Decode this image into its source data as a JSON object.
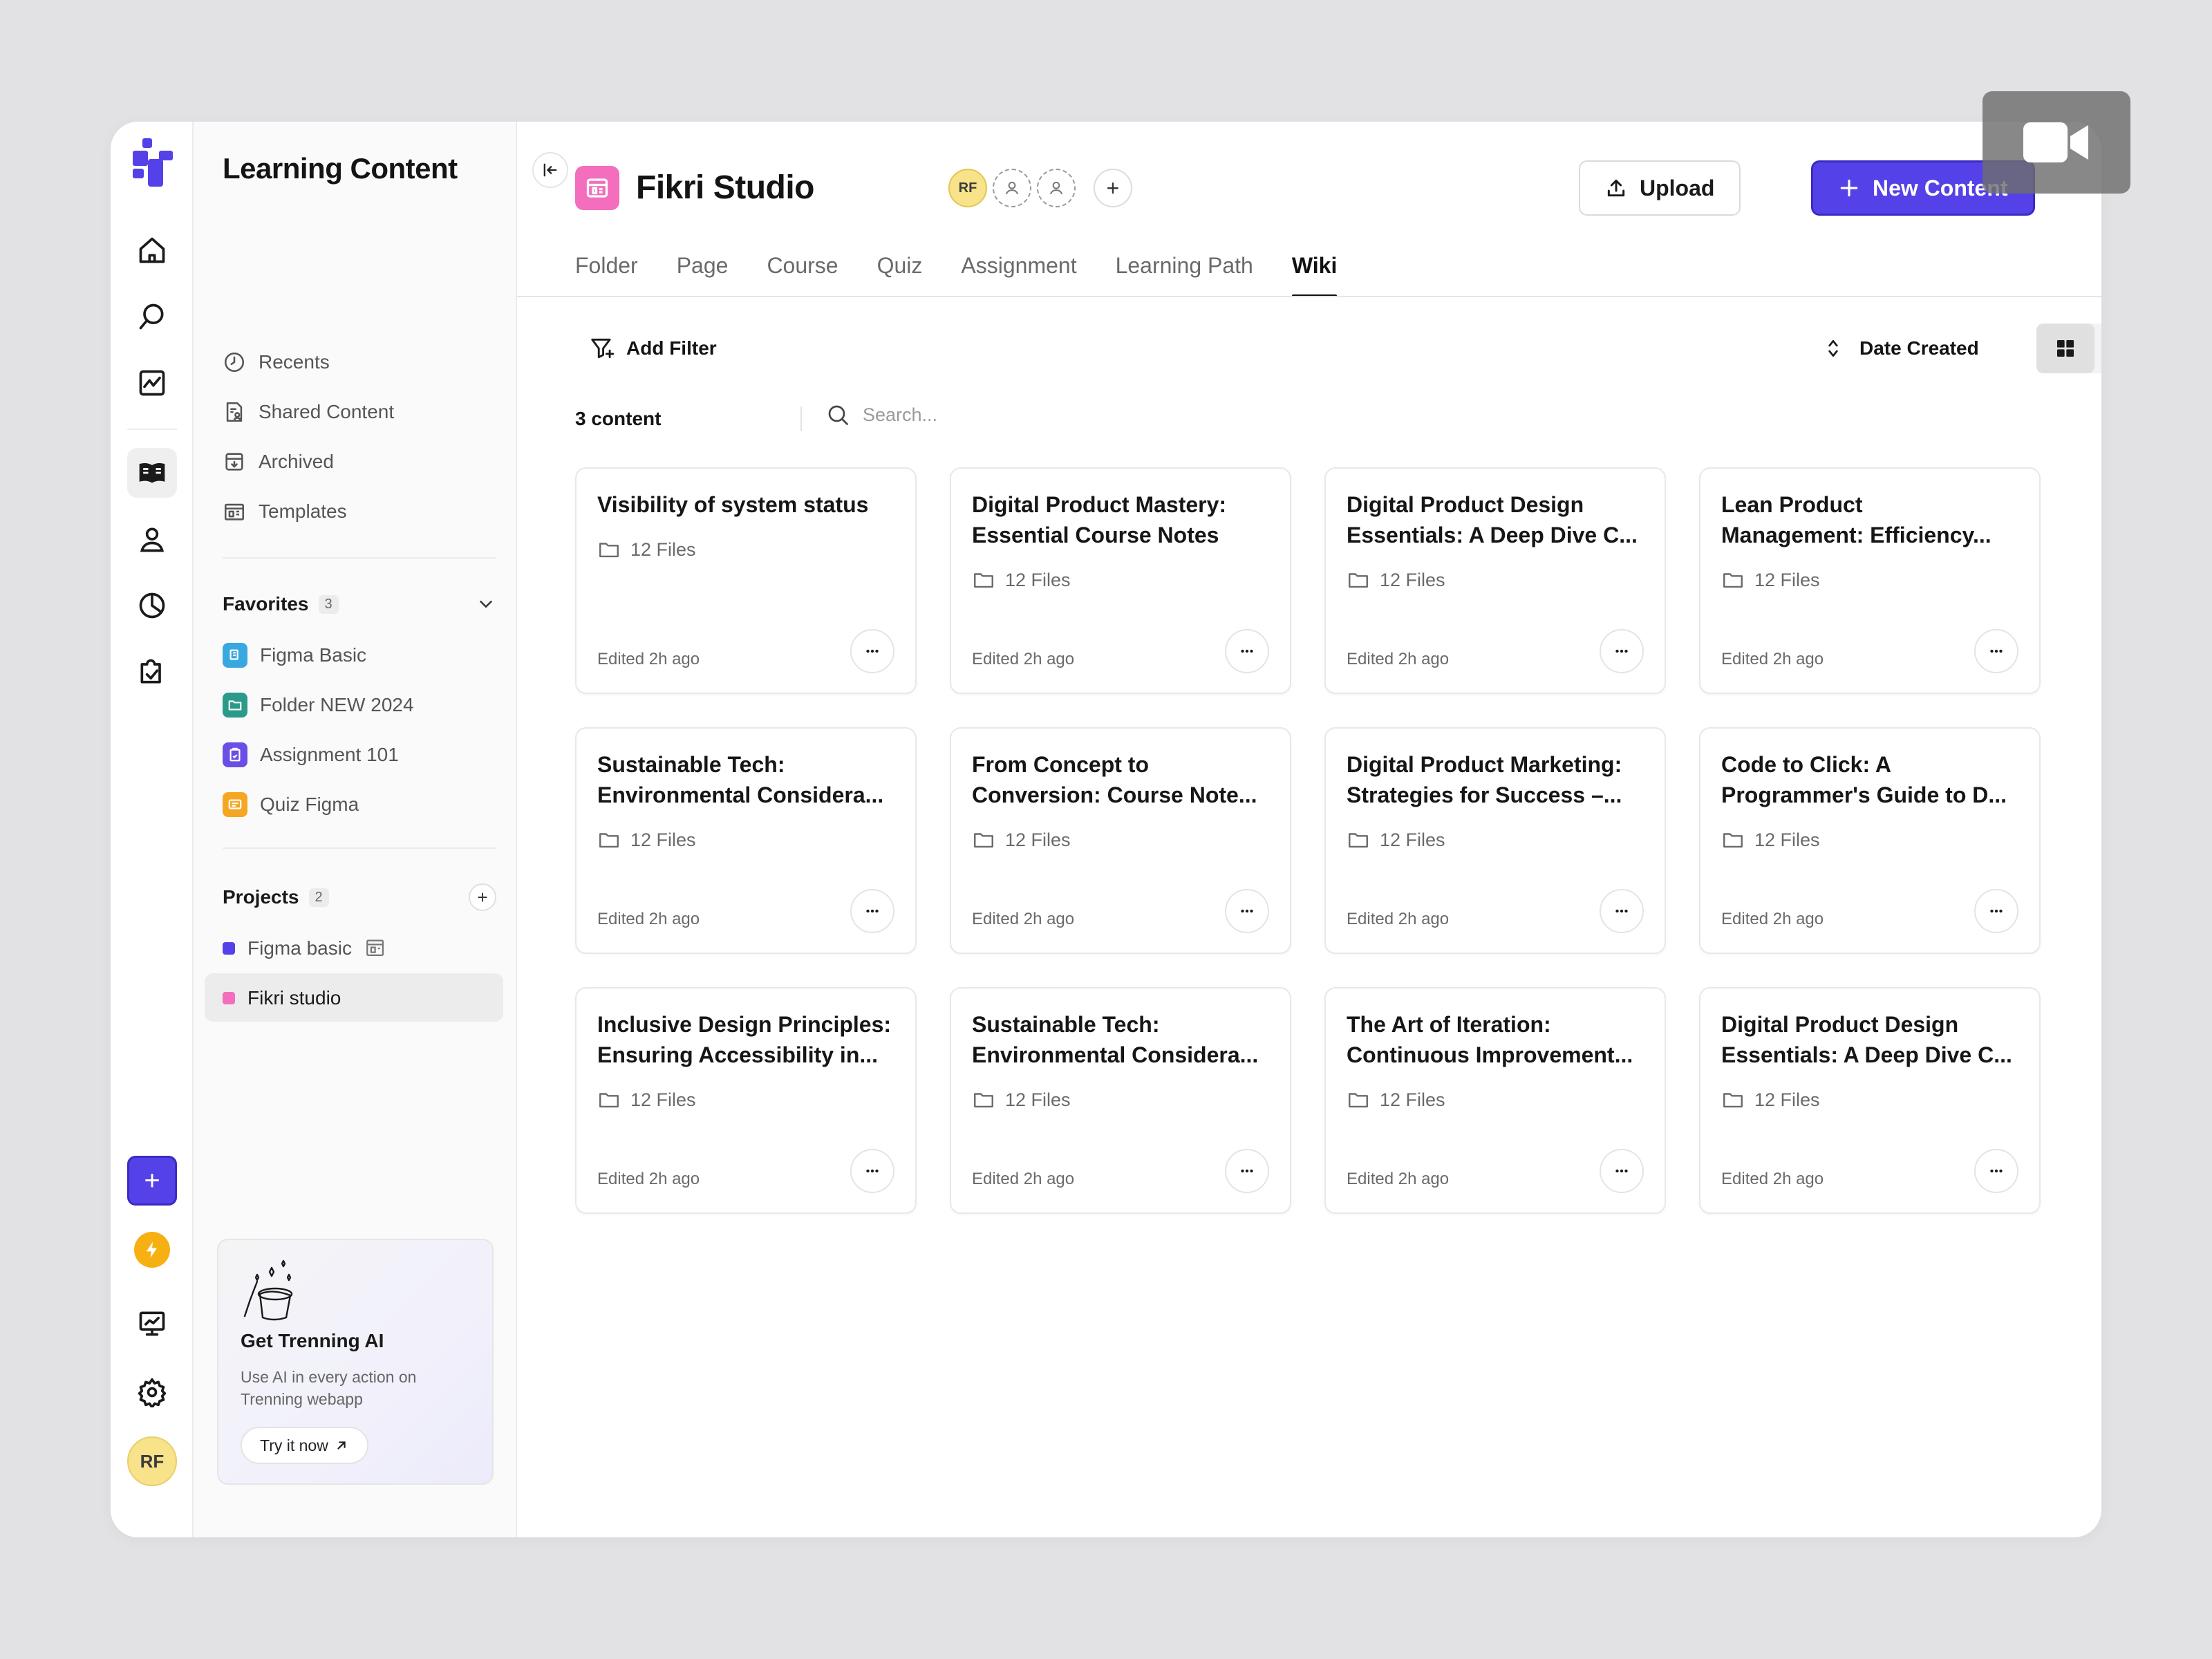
{
  "sidebar": {
    "title": "Learning Content",
    "nav": [
      {
        "label": "Recents",
        "icon": "clock-icon"
      },
      {
        "label": "Shared Content",
        "icon": "shared-doc-icon"
      },
      {
        "label": "Archived",
        "icon": "archive-icon"
      },
      {
        "label": "Templates",
        "icon": "template-icon"
      }
    ],
    "favorites": {
      "label": "Favorites",
      "count": "3",
      "items": [
        {
          "label": "Figma Basic",
          "color": "#3aa8e0"
        },
        {
          "label": "Folder NEW 2024",
          "color": "#2c9a8a"
        },
        {
          "label": "Assignment 101",
          "color": "#6a4ee6"
        },
        {
          "label": "Quiz Figma",
          "color": "#f5a623"
        }
      ]
    },
    "projects": {
      "label": "Projects",
      "count": "2",
      "items": [
        {
          "label": "Figma basic",
          "color": "#5541e8"
        },
        {
          "label": "Fikri studio",
          "color": "#f36ebd"
        }
      ]
    },
    "ai_card": {
      "title": "Get Trenning AI",
      "description": "Use AI in every action on Trenning webapp",
      "button": "Try it now"
    }
  },
  "rail": {
    "avatar": "RF",
    "accent": "#5541e8"
  },
  "header": {
    "title": "Fikri Studio",
    "member_initials": "RF",
    "upload_label": "Upload",
    "new_label": "New Content"
  },
  "tabs": [
    {
      "label": "Folder"
    },
    {
      "label": "Page"
    },
    {
      "label": "Course"
    },
    {
      "label": "Quiz"
    },
    {
      "label": "Assignment"
    },
    {
      "label": "Learning Path"
    },
    {
      "label": "Wiki",
      "active": true
    }
  ],
  "toolbar": {
    "filter_label": "Add Filter",
    "sort_label": "Date Created",
    "content_count": "3 content",
    "search_placeholder": "Search..."
  },
  "cards": [
    {
      "title1": "Visibility of system status",
      "title2": "",
      "files": "12 Files",
      "edited": "Edited 2h ago"
    },
    {
      "title1": "Digital Product Mastery:",
      "title2": "Essential Course Notes",
      "files": "12 Files",
      "edited": "Edited 2h ago"
    },
    {
      "title1": "Digital Product Design",
      "title2": "Essentials: A Deep Dive C...",
      "files": "12 Files",
      "edited": "Edited 2h ago"
    },
    {
      "title1": "Lean Product",
      "title2": "Management: Efficiency...",
      "files": "12 Files",
      "edited": "Edited 2h ago"
    },
    {
      "title1": "Sustainable Tech:",
      "title2": "Environmental Considera...",
      "files": "12 Files",
      "edited": "Edited 2h ago"
    },
    {
      "title1": "From Concept to",
      "title2": "Conversion: Course Note...",
      "files": "12 Files",
      "edited": "Edited 2h ago"
    },
    {
      "title1": "Digital Product Marketing:",
      "title2": "Strategies for Success –...",
      "files": "12 Files",
      "edited": "Edited 2h ago"
    },
    {
      "title1": "Code to Click: A",
      "title2": "Programmer's Guide to D...",
      "files": "12 Files",
      "edited": "Edited 2h ago"
    },
    {
      "title1": "Inclusive Design Principles:",
      "title2": "Ensuring Accessibility in...",
      "files": "12 Files",
      "edited": "Edited 2h ago"
    },
    {
      "title1": "Sustainable Tech:",
      "title2": "Environmental Considera...",
      "files": "12 Files",
      "edited": "Edited 2h ago"
    },
    {
      "title1": "The Art of Iteration:",
      "title2": "Continuous Improvement...",
      "files": "12 Files",
      "edited": "Edited 2h ago"
    },
    {
      "title1": "Digital Product Design",
      "title2": "Essentials: A Deep Dive C...",
      "files": "12 Files",
      "edited": "Edited 2h ago"
    }
  ],
  "help_label": "?"
}
